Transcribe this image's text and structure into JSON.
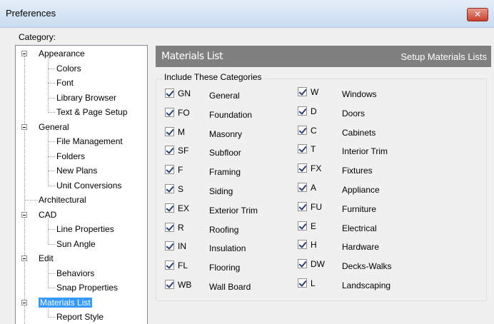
{
  "window": {
    "title": "Preferences",
    "close_glyph": "✕"
  },
  "category_label": "Category:",
  "tree": [
    {
      "label": "Appearance",
      "children": [
        "Colors",
        "Font",
        "Library Browser",
        "Text & Page Setup"
      ]
    },
    {
      "label": "General",
      "children": [
        "File Management",
        "Folders",
        "New Plans",
        "Unit Conversions"
      ]
    },
    {
      "label": "Architectural",
      "children": []
    },
    {
      "label": "CAD",
      "children": [
        "Line Properties",
        "Sun Angle"
      ]
    },
    {
      "label": "Edit",
      "children": [
        "Behaviors",
        "Snap Properties"
      ]
    },
    {
      "label": "Materials List",
      "children": [
        "Report Style"
      ]
    }
  ],
  "selected_item": "Materials List",
  "panel": {
    "title": "Materials List",
    "subtitle": "Setup Materials Lists"
  },
  "group": {
    "legend": "Include These Categories",
    "left": [
      {
        "code": "GN",
        "name": "General",
        "checked": true
      },
      {
        "code": "FO",
        "name": "Foundation",
        "checked": true
      },
      {
        "code": "M",
        "name": "Masonry",
        "checked": true
      },
      {
        "code": "SF",
        "name": "Subfloor",
        "checked": true
      },
      {
        "code": "F",
        "name": "Framing",
        "checked": true
      },
      {
        "code": "S",
        "name": "Siding",
        "checked": true
      },
      {
        "code": "EX",
        "name": "Exterior Trim",
        "checked": true
      },
      {
        "code": "R",
        "name": "Roofing",
        "checked": true
      },
      {
        "code": "IN",
        "name": "Insulation",
        "checked": true
      },
      {
        "code": "FL",
        "name": "Flooring",
        "checked": true
      },
      {
        "code": "WB",
        "name": "Wall Board",
        "checked": true
      }
    ],
    "right": [
      {
        "code": "W",
        "name": "Windows",
        "checked": true
      },
      {
        "code": "D",
        "name": "Doors",
        "checked": true
      },
      {
        "code": "C",
        "name": "Cabinets",
        "checked": true
      },
      {
        "code": "T",
        "name": "Interior Trim",
        "checked": true
      },
      {
        "code": "FX",
        "name": "Fixtures",
        "checked": true
      },
      {
        "code": "A",
        "name": "Appliance",
        "checked": true
      },
      {
        "code": "FU",
        "name": "Furniture",
        "checked": true
      },
      {
        "code": "E",
        "name": "Electrical",
        "checked": true
      },
      {
        "code": "H",
        "name": "Hardware",
        "checked": true
      },
      {
        "code": "DW",
        "name": "Decks-Walks",
        "checked": true
      },
      {
        "code": "L",
        "name": "Landscaping",
        "checked": true
      }
    ]
  },
  "colors": {
    "selection": "#3399ff",
    "header_bg": "#7f7f7f",
    "close_red": "#c8402c"
  }
}
